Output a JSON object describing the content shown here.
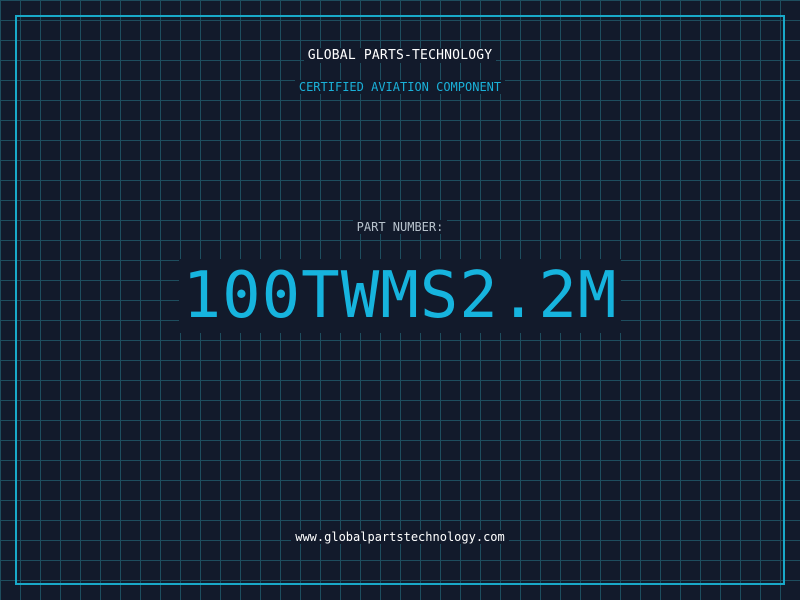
{
  "header": {
    "brand": "GLOBAL PARTS-TECHNOLOGY",
    "tagline": "CERTIFIED AVIATION COMPONENT"
  },
  "part": {
    "label": "PART NUMBER:",
    "number": "100TWMS2.2M"
  },
  "footer": {
    "website": "www.globalpartstechnology.com"
  },
  "colors": {
    "background": "#121a2b",
    "grid": "#1e4d5e",
    "accent": "#16b4de",
    "text": "#ffffff"
  }
}
